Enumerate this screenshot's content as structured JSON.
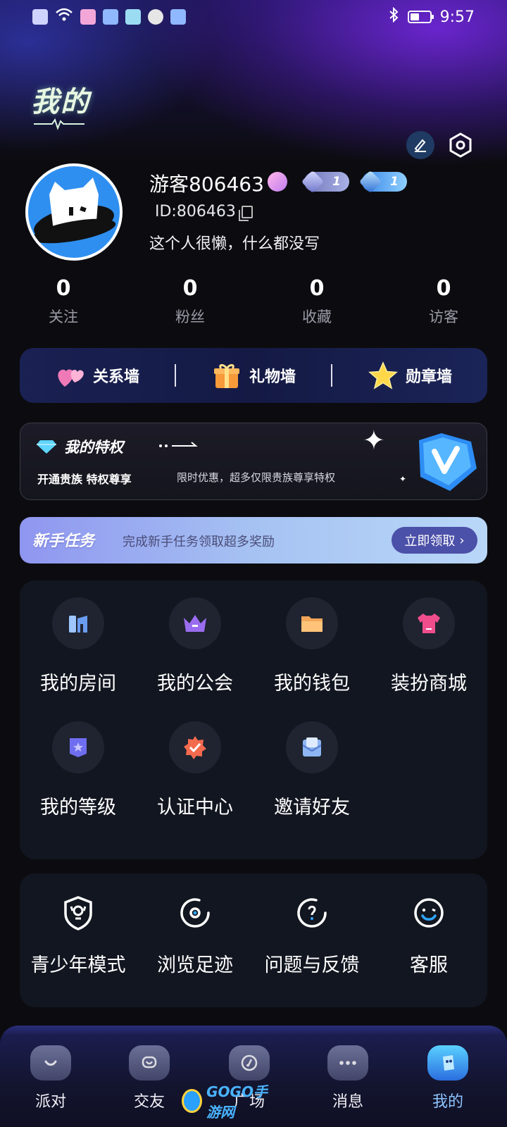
{
  "status_bar": {
    "time": "9:57"
  },
  "header": {
    "title": "我的"
  },
  "profile": {
    "username": "游客806463",
    "id_text": "ID:806463",
    "bio": "这个人很懒，什么都没写",
    "level_badges": [
      "1",
      "1"
    ]
  },
  "stats": [
    {
      "value": "0",
      "label": "关注"
    },
    {
      "value": "0",
      "label": "粉丝"
    },
    {
      "value": "0",
      "label": "收藏"
    },
    {
      "value": "0",
      "label": "访客"
    }
  ],
  "walls": [
    {
      "label": "关系墙",
      "icon": "hearts-icon"
    },
    {
      "label": "礼物墙",
      "icon": "gift-icon"
    },
    {
      "label": "勋章墙",
      "icon": "star-icon"
    }
  ],
  "privilege": {
    "title": "我的特权",
    "subtitle": "开通贵族 特权尊享",
    "description": "限时优惠，超多仅限贵族尊享特权"
  },
  "task": {
    "title": "新手任务",
    "description": "完成新手任务领取超多奖励",
    "button": "立即领取"
  },
  "features": [
    {
      "label": "我的房间",
      "icon": "room-icon"
    },
    {
      "label": "我的公会",
      "icon": "crown-icon"
    },
    {
      "label": "我的钱包",
      "icon": "wallet-icon"
    },
    {
      "label": "装扮商城",
      "icon": "shirt-icon"
    },
    {
      "label": "我的等级",
      "icon": "level-icon"
    },
    {
      "label": "认证中心",
      "icon": "verify-icon"
    },
    {
      "label": "邀请好友",
      "icon": "invite-icon"
    }
  ],
  "tools": [
    {
      "label": "青少年模式",
      "icon": "shield-icon"
    },
    {
      "label": "浏览足迹",
      "icon": "footprint-icon"
    },
    {
      "label": "问题与反馈",
      "icon": "feedback-icon"
    },
    {
      "label": "客服",
      "icon": "service-icon"
    }
  ],
  "nav": [
    {
      "label": "派对",
      "icon": "party-icon"
    },
    {
      "label": "交友",
      "icon": "friends-icon"
    },
    {
      "label": "广场",
      "icon": "square-icon"
    },
    {
      "label": "消息",
      "icon": "message-icon"
    },
    {
      "label": "我的",
      "icon": "me-icon",
      "active": true
    }
  ],
  "watermark": "GOGO手游网",
  "battery_level": 0.45
}
